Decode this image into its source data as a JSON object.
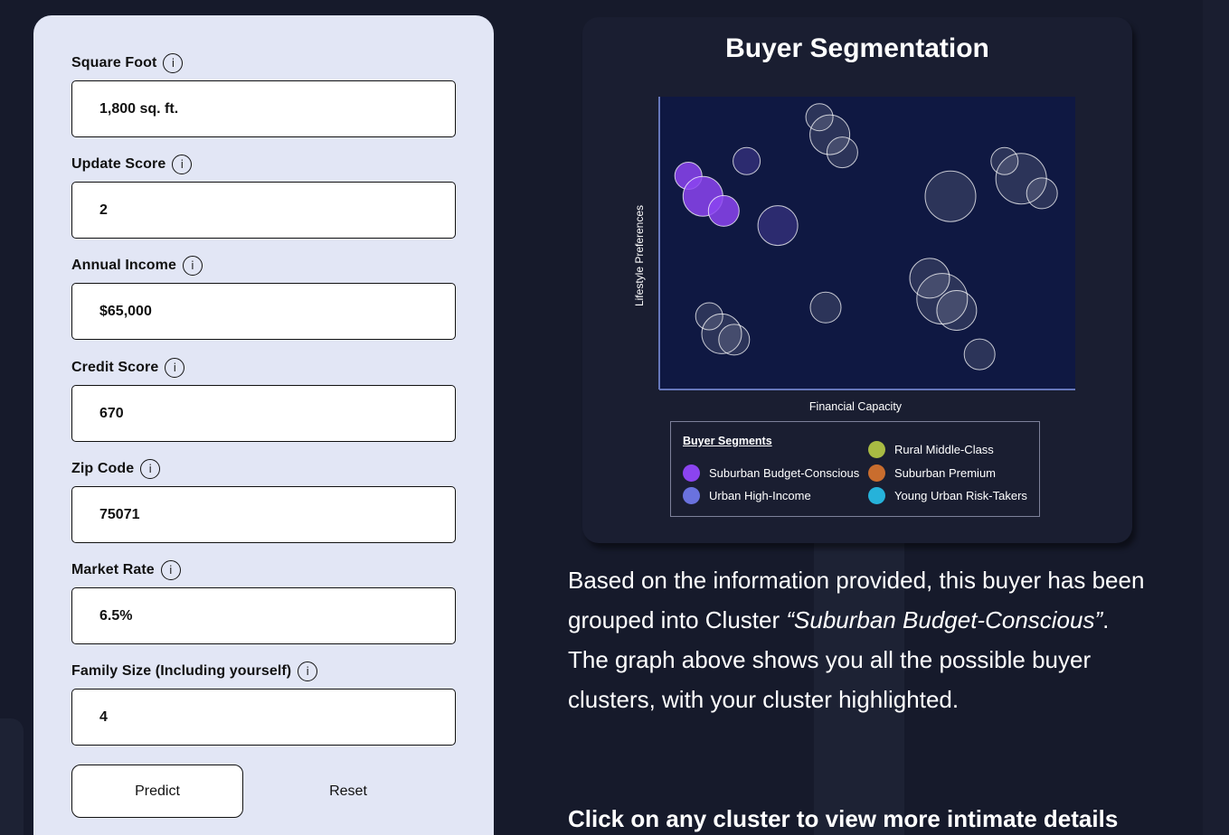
{
  "form": {
    "fields": [
      {
        "label": "Square Foot",
        "value": "1,800 sq. ft."
      },
      {
        "label": "Update Score",
        "value": "2"
      },
      {
        "label": "Annual Income",
        "value": "$65,000"
      },
      {
        "label": "Credit Score",
        "value": "670"
      },
      {
        "label": "Zip Code",
        "value": "75071"
      },
      {
        "label": "Market Rate",
        "value": "6.5%"
      },
      {
        "label": "Family Size (Including yourself)",
        "value": "4"
      }
    ],
    "info_glyph": "i",
    "predict_label": "Predict",
    "reset_label": "Reset"
  },
  "chart_data": {
    "type": "scatter",
    "title": "Buyer Segmentation",
    "xlabel": "Financial Capacity",
    "ylabel": "Lifestyle Preferences",
    "xlim": [
      0,
      100
    ],
    "ylim": [
      0,
      100
    ],
    "highlighted_segment": "Suburban Budget-Conscious",
    "points": [
      {
        "x": 7,
        "y": 73,
        "r": 15,
        "segment": "Suburban Budget-Conscious"
      },
      {
        "x": 10.5,
        "y": 66,
        "r": 22,
        "segment": "Suburban Budget-Conscious"
      },
      {
        "x": 15.5,
        "y": 61,
        "r": 17,
        "segment": "Suburban Budget-Conscious"
      },
      {
        "x": 21,
        "y": 78,
        "r": 15,
        "segment": "Urban High-Income"
      },
      {
        "x": 28.5,
        "y": 56,
        "r": 22,
        "segment": "Urban High-Income"
      },
      {
        "x": 38.5,
        "y": 93,
        "r": 15,
        "segment": "other"
      },
      {
        "x": 41,
        "y": 87,
        "r": 22,
        "segment": "other"
      },
      {
        "x": 44,
        "y": 81,
        "r": 17,
        "segment": "other"
      },
      {
        "x": 70,
        "y": 66,
        "r": 28,
        "segment": "other"
      },
      {
        "x": 83,
        "y": 78,
        "r": 15,
        "segment": "other"
      },
      {
        "x": 87,
        "y": 72,
        "r": 28,
        "segment": "other"
      },
      {
        "x": 92,
        "y": 67,
        "r": 17,
        "segment": "other"
      },
      {
        "x": 40,
        "y": 28,
        "r": 17,
        "segment": "other"
      },
      {
        "x": 12,
        "y": 25,
        "r": 15,
        "segment": "other"
      },
      {
        "x": 15,
        "y": 19,
        "r": 22,
        "segment": "other"
      },
      {
        "x": 18,
        "y": 17,
        "r": 17,
        "segment": "other"
      },
      {
        "x": 65,
        "y": 38,
        "r": 22,
        "segment": "other"
      },
      {
        "x": 68,
        "y": 31,
        "r": 28,
        "segment": "other"
      },
      {
        "x": 71.5,
        "y": 27,
        "r": 22,
        "segment": "other"
      },
      {
        "x": 77,
        "y": 12,
        "r": 17,
        "segment": "other"
      }
    ],
    "legend_title": "Buyer Segments",
    "legend": [
      {
        "name": "Suburban Budget-Conscious",
        "color": "#8b44f0"
      },
      {
        "name": "Urban High-Income",
        "color": "#6a72de"
      },
      {
        "name": "Rural Middle-Class",
        "color": "#a9bb43"
      },
      {
        "name": "Suburban Premium",
        "color": "#c96d2e"
      },
      {
        "name": "Young Urban Risk-Takers",
        "color": "#26b2da"
      }
    ]
  },
  "description": {
    "part1": "Based on the information provided, this buyer has been grouped into Cluster ",
    "cluster_quote": "“Suburban Budget-Conscious”",
    "part2": ". The graph above shows you all the possible buyer clusters, with your cluster highlighted."
  },
  "cta": "Click on any cluster to view more intimate details"
}
